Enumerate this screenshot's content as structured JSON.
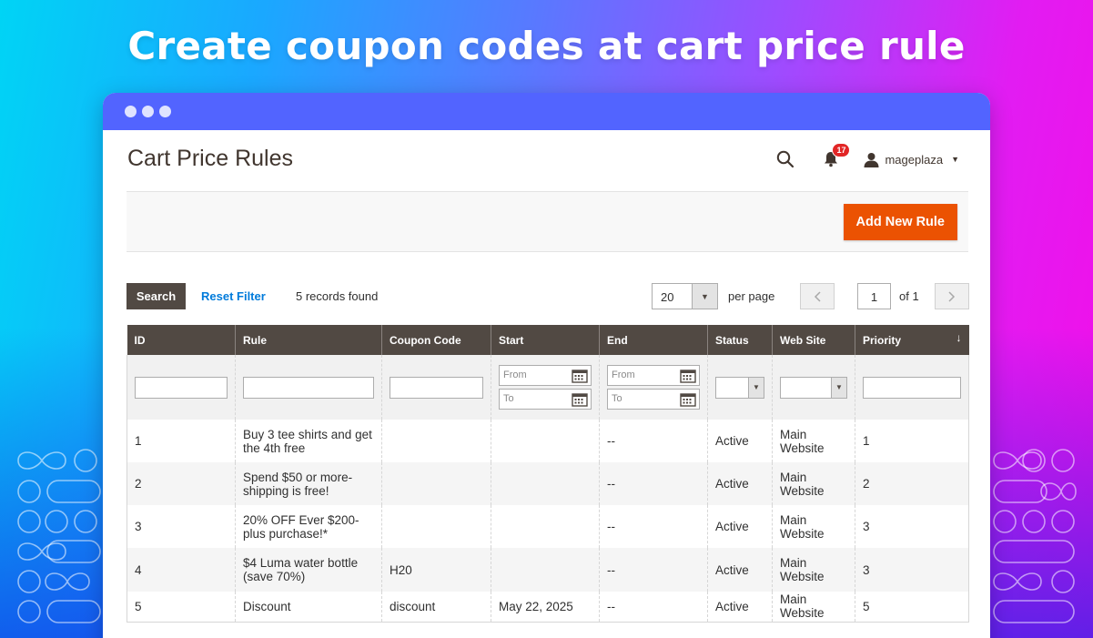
{
  "banner": {
    "title": "Create coupon codes at cart price rule"
  },
  "page": {
    "title": "Cart Price Rules"
  },
  "header": {
    "notification_count": "17",
    "username": "mageplaza"
  },
  "actions": {
    "add_new_rule_label": "Add New Rule"
  },
  "toolbar": {
    "search_label": "Search",
    "reset_filter_label": "Reset Filter",
    "records_found": "5 records found",
    "per_page_value": "20",
    "per_page_label": "per page",
    "current_page": "1",
    "of_pages": "of 1"
  },
  "grid": {
    "columns": [
      "ID",
      "Rule",
      "Coupon Code",
      "Start",
      "End",
      "Status",
      "Web Site",
      "Priority"
    ],
    "filters": {
      "from_placeholder": "From",
      "to_placeholder": "To"
    },
    "rows": [
      {
        "id": "1",
        "rule": "Buy 3 tee shirts and get the 4th free",
        "coupon": "",
        "start": "",
        "end": "--",
        "status": "Active",
        "website": "Main Website",
        "priority": "1"
      },
      {
        "id": "2",
        "rule": "Spend $50 or more- shipping is free!",
        "coupon": "",
        "start": "",
        "end": "--",
        "status": "Active",
        "website": "Main Website",
        "priority": "2"
      },
      {
        "id": "3",
        "rule": "20% OFF Ever $200- plus purchase!*",
        "coupon": "",
        "start": "",
        "end": "--",
        "status": "Active",
        "website": "Main Website",
        "priority": "3"
      },
      {
        "id": "4",
        "rule": "$4 Luma water bottle (save 70%)",
        "coupon": "H20",
        "start": "",
        "end": "--",
        "status": "Active",
        "website": "Main Website",
        "priority": "3"
      },
      {
        "id": "5",
        "rule": "Discount",
        "coupon": "discount",
        "start": "May 22, 2025",
        "end": "--",
        "status": "Active",
        "website": "Main Website",
        "priority": "5"
      }
    ]
  },
  "colors": {
    "accent": "#eb5202",
    "header_bg": "#514943",
    "link": "#007bdb",
    "titlebar": "#5264ff"
  }
}
